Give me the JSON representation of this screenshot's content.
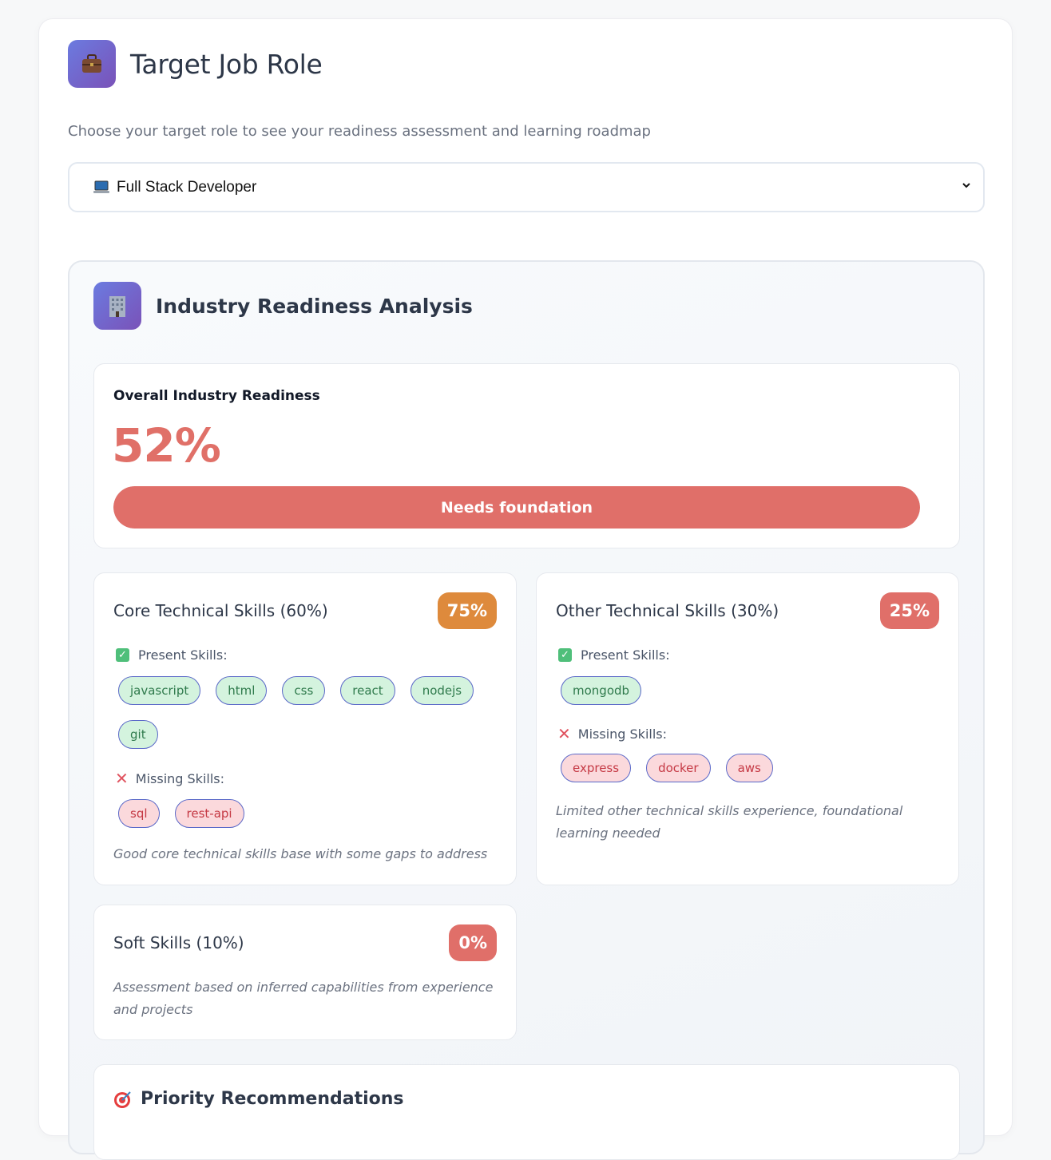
{
  "header": {
    "icon": "briefcase-icon",
    "title": "Target Job Role",
    "subtitle": "Choose your target role to see your readiness assessment and learning roadmap"
  },
  "role_select": {
    "icon": "laptop-icon",
    "selected": "Full Stack Developer"
  },
  "analysis": {
    "icon": "office-building-icon",
    "title": "Industry Readiness Analysis",
    "overall": {
      "label": "Overall Industry Readiness",
      "percent_text": "52%",
      "percent": 52,
      "bar_label": "Needs foundation"
    },
    "core": {
      "title": "Core Technical Skills (60%)",
      "score": "75%",
      "present_label": "Present Skills:",
      "present": [
        "javascript",
        "html",
        "css",
        "react",
        "nodejs",
        "git"
      ],
      "missing_label": "Missing Skills:",
      "missing": [
        "sql",
        "rest-api"
      ],
      "note": "Good core technical skills base with some gaps to address"
    },
    "other": {
      "title": "Other Technical Skills (30%)",
      "score": "25%",
      "present_label": "Present Skills:",
      "present": [
        "mongodb"
      ],
      "missing_label": "Missing Skills:",
      "missing": [
        "express",
        "docker",
        "aws"
      ],
      "note": "Limited other technical skills experience, foundational learning needed"
    },
    "soft": {
      "title": "Soft Skills (10%)",
      "score": "0%",
      "note": "Assessment based on inferred capabilities from experience and projects"
    },
    "priority": {
      "icon": "target-icon",
      "title": "Priority Recommendations"
    }
  },
  "colors": {
    "accent_gradient_start": "#6b7be0",
    "accent_gradient_end": "#7a52b8",
    "danger": "#e06f69",
    "warning": "#de8a3c",
    "success_tag_bg": "#d4f3de",
    "missing_tag_bg": "#fbd9dc"
  }
}
